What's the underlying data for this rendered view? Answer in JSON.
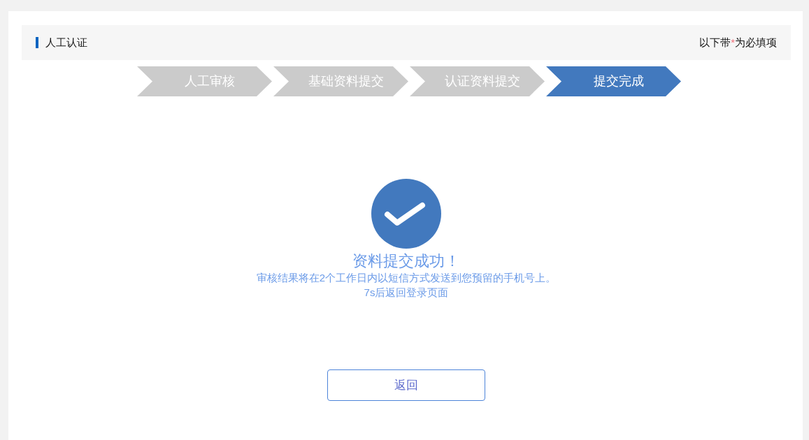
{
  "header": {
    "title": "人工认证",
    "required_note": {
      "before": "以下带",
      "mark": "*",
      "after": "为必填项"
    }
  },
  "steps": [
    {
      "label": "人工审核",
      "selected": false
    },
    {
      "label": "基础资料提交",
      "selected": false
    },
    {
      "label": "认证资料提交",
      "selected": false
    },
    {
      "label": "提交完成",
      "selected": true
    }
  ],
  "result": {
    "title": "资料提交成功！",
    "message": "审核结果将在2个工作日内以短信方式发送到您预留的手机号上。",
    "countdown": "7s后返回登录页面"
  },
  "back_button": {
    "label": "返回"
  }
}
